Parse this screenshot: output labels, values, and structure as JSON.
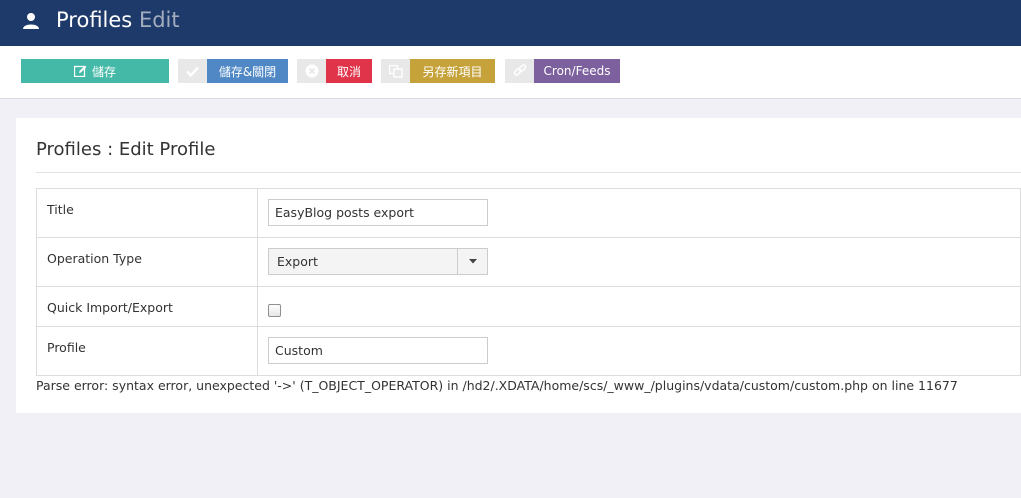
{
  "header": {
    "title": "Profiles",
    "subtitle": "Edit"
  },
  "toolbar": {
    "save_label": "儲存",
    "save_close_label": "儲存&關閉",
    "cancel_label": "取消",
    "save_as_new_label": "另存新項目",
    "cron_feeds_label": "Cron/Feeds",
    "colors": {
      "save": "#45b9a8",
      "save_close": "#4f88c5",
      "cancel": "#e0344a",
      "save_as_new": "#c6a23b",
      "cron_feeds": "#7d619f"
    }
  },
  "panel": {
    "title": "Profiles : Edit Profile"
  },
  "form": {
    "title_label": "Title",
    "title_value": "EasyBlog posts export",
    "operation_type_label": "Operation Type",
    "operation_type_value": "Export",
    "quick_label": "Quick Import/Export",
    "quick_checked": false,
    "profile_label": "Profile",
    "profile_value": "Custom"
  },
  "error_message": "Parse error: syntax error, unexpected '->' (T_OBJECT_OPERATOR) in /hd2/.XDATA/home/scs/_www_/plugins/vdata/custom/custom.php on line 11677"
}
